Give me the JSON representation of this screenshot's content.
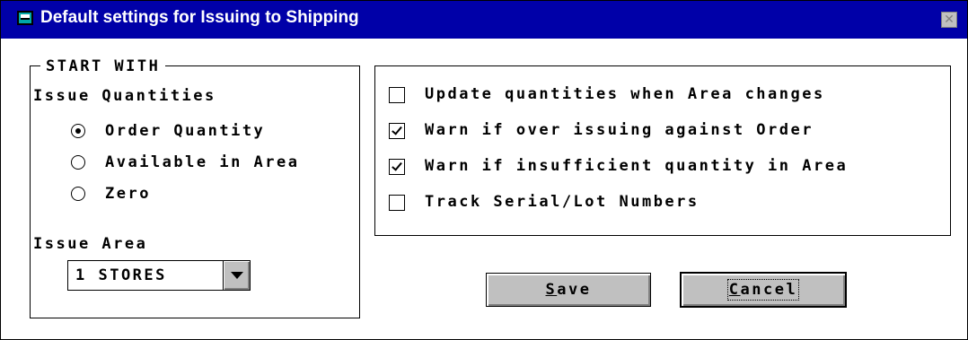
{
  "window": {
    "title": "Default settings for Issuing to Shipping"
  },
  "start_with": {
    "legend": "START WITH",
    "issue_quantities_label": "Issue Quantities",
    "radios": [
      {
        "label": "Order Quantity",
        "selected": true
      },
      {
        "label": "Available in Area",
        "selected": false
      },
      {
        "label": "Zero",
        "selected": false
      }
    ],
    "issue_area_label": "Issue Area",
    "issue_area_value": "1 STORES"
  },
  "options": [
    {
      "label": "Update quantities when Area changes",
      "checked": false
    },
    {
      "label": "Warn if over issuing against Order",
      "checked": true
    },
    {
      "label": "Warn if insufficient quantity in Area",
      "checked": true
    },
    {
      "label": "Track Serial/Lot Numbers",
      "checked": false
    }
  ],
  "buttons": {
    "save": {
      "mnemonic": "S",
      "rest": "ave"
    },
    "cancel": {
      "mnemonic": "C",
      "rest": "ancel"
    }
  }
}
